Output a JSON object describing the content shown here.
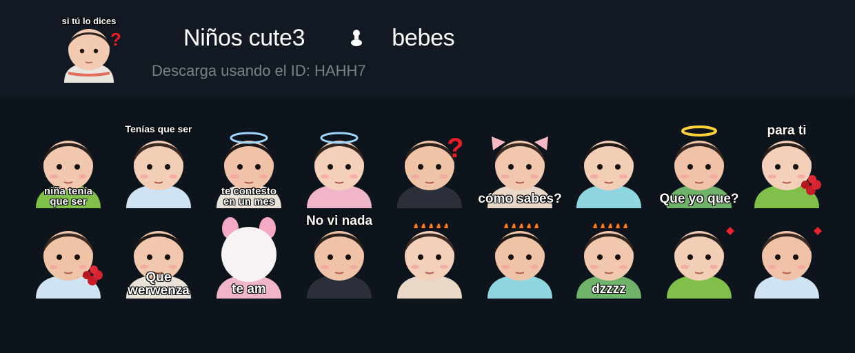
{
  "pack": {
    "title": "Niños cute3",
    "title_suffix": "bebes",
    "separator_icon": "pacifier-icon",
    "download_text": "Descarga usando el ID: HAHH7",
    "cover_caption": "si tú lo dices"
  },
  "stickers": [
    {
      "caption": "niña tenía\nque ser",
      "pos": "bottom"
    },
    {
      "caption": "Tenías que ser",
      "pos": "top"
    },
    {
      "caption": "te contesto\nen un mes",
      "pos": "bottom"
    },
    {
      "caption": "",
      "pos": "none"
    },
    {
      "caption": "",
      "pos": "none"
    },
    {
      "caption": "cómo sabes?",
      "pos": "bottom"
    },
    {
      "caption": "",
      "pos": "none"
    },
    {
      "caption": "Que yo que?",
      "pos": "bottom"
    },
    {
      "caption": "para ti",
      "pos": "top"
    },
    {
      "caption": "",
      "pos": "none"
    },
    {
      "caption": "Que\nwerwenza",
      "pos": "bottom"
    },
    {
      "caption": "te am",
      "pos": "bottom"
    },
    {
      "caption": "No vi nada",
      "pos": "top"
    },
    {
      "caption": "",
      "pos": "none"
    },
    {
      "caption": "",
      "pos": "none"
    },
    {
      "caption": "dzzzz",
      "pos": "bottom"
    },
    {
      "caption": "",
      "pos": "none"
    },
    {
      "caption": "",
      "pos": "none"
    }
  ],
  "colors": {
    "header_bg": "#121922",
    "page_bg": "#0e141c",
    "muted_text": "#7c8188"
  }
}
